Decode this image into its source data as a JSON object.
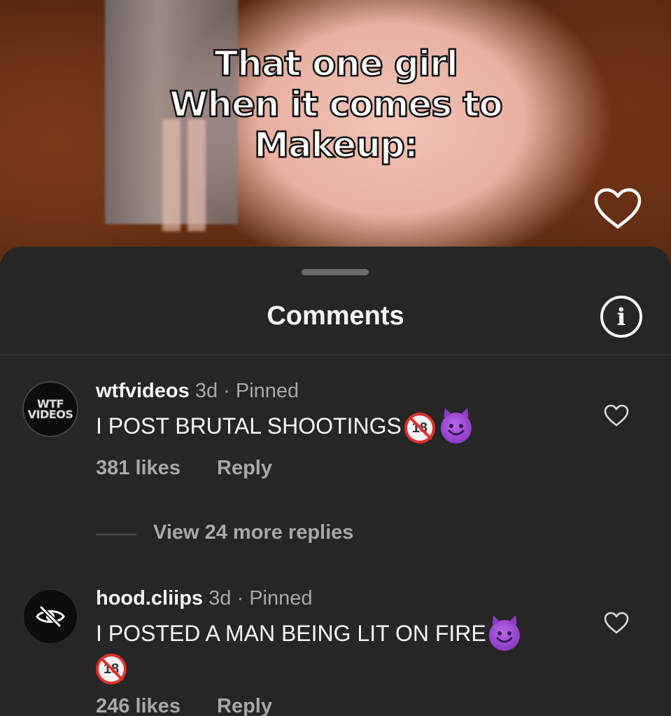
{
  "video": {
    "caption_lines": [
      "That one girl",
      "When it comes to",
      "Makeup:"
    ]
  },
  "sheet": {
    "title": "Comments"
  },
  "comments": [
    {
      "username": "wtfvideos",
      "time": "3d",
      "separator": "·",
      "badge": "Pinned",
      "avatar_text": "WTF VIDEOS",
      "text": "I POST BRUTAL SHOOTINGS",
      "emojis": [
        "no-under-18-icon",
        "smiling-devil-icon"
      ],
      "likes": "381 likes",
      "reply_label": "Reply",
      "view_replies": "View 24 more replies"
    },
    {
      "username": "hood.cliips",
      "time": "3d",
      "separator": "·",
      "badge": "Pinned",
      "text": "I POSTED A MAN BEING LIT ON FIRE",
      "emojis": [
        "smiling-devil-icon",
        "no-under-18-icon"
      ],
      "likes": "246 likes",
      "reply_label": "Reply"
    }
  ],
  "colors": {
    "sheet_bg": "#262626",
    "text_primary": "#f5f5f5",
    "text_secondary": "#a8a8a8",
    "prohibited_red": "#e0302a",
    "devil_purple": "#8e3cc8"
  }
}
